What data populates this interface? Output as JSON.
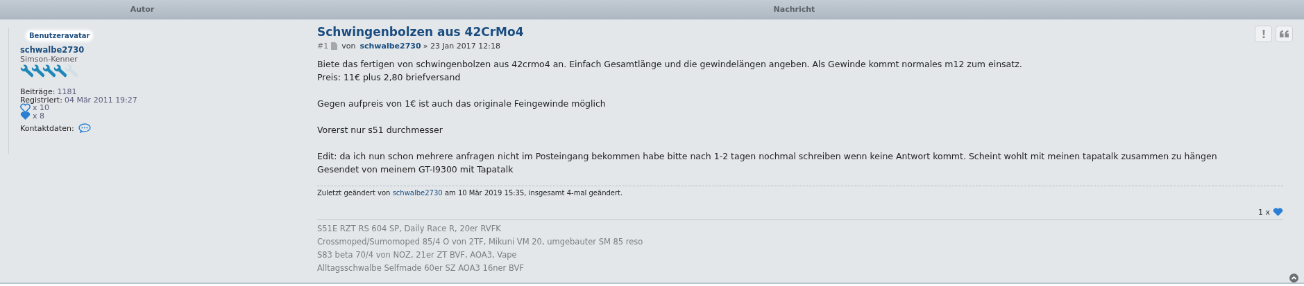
{
  "table": {
    "columns": [
      "Autor",
      "Nachricht"
    ]
  },
  "author": {
    "avatar_label": "Benutzeravatar",
    "username": "schwalbe2730",
    "rank": "Simson-Kenner",
    "stars": 4,
    "stats": [
      {
        "kind": "text",
        "label": "Beiträge:",
        "value": "1181"
      },
      {
        "kind": "text",
        "label": "Registriert:",
        "value": "04 Mär 2011 19:27"
      },
      {
        "kind": "heart-outline",
        "value": "x 10"
      },
      {
        "kind": "heart",
        "value": "x 8"
      },
      {
        "kind": "contact",
        "label": "Kontaktdaten:"
      }
    ]
  },
  "post": {
    "title": "Schwingenbolzen aus 42CrMo4",
    "number": "#1",
    "by": "von",
    "author": "schwalbe2730",
    "date": "» 23 Jan 2017 12:18",
    "body": [
      {
        "lines": [
          "Biete das fertigen von schwingenbolzen aus 42crmo4 an. Einfach Gesamtlänge und die gewindelängen angeben. Als Gewinde kommt normales m12 zum einsatz.",
          "Preis: 11€ plus 2,80 briefversand"
        ]
      },
      {
        "lines": [
          "Gegen aufpreis von 1€ ist auch das originale Feingewinde möglich"
        ]
      },
      {
        "lines": [
          "Vorerst nur s51 durchmesser"
        ]
      },
      {
        "lines": [
          "Edit: da ich nun schon mehrere anfragen nicht im Posteingang bekommen habe bitte nach 1-2 tagen nochmal schreiben wenn keine Antwort kommt. Scheint wohlt mit meinen tapatalk zusammen zu hängen",
          "Gesendet von meinem GT-I9300 mit Tapatalk"
        ]
      }
    ],
    "edit_note": {
      "prefix": "Zuletzt geändert von",
      "user": "schwalbe2730",
      "suffix": "am 10 Mär 2019 15:35, insgesamt 4-mal geändert."
    },
    "likes": {
      "count": "1 x"
    },
    "signature": [
      "S51E RZT RS 604 SP, Daily Race R, 20er RVFK",
      "Crossmoped/Sumomoped 85/4 O von 2TF, Mikuni VM 20, umgebauter SM 85 reso",
      "S83 beta 70/4 von NOZ, 21er ZT BVF, AOA3, Vape",
      "Alltagsschwalbe Selfmade 60er SZ AOA3 16ner BVF"
    ]
  }
}
